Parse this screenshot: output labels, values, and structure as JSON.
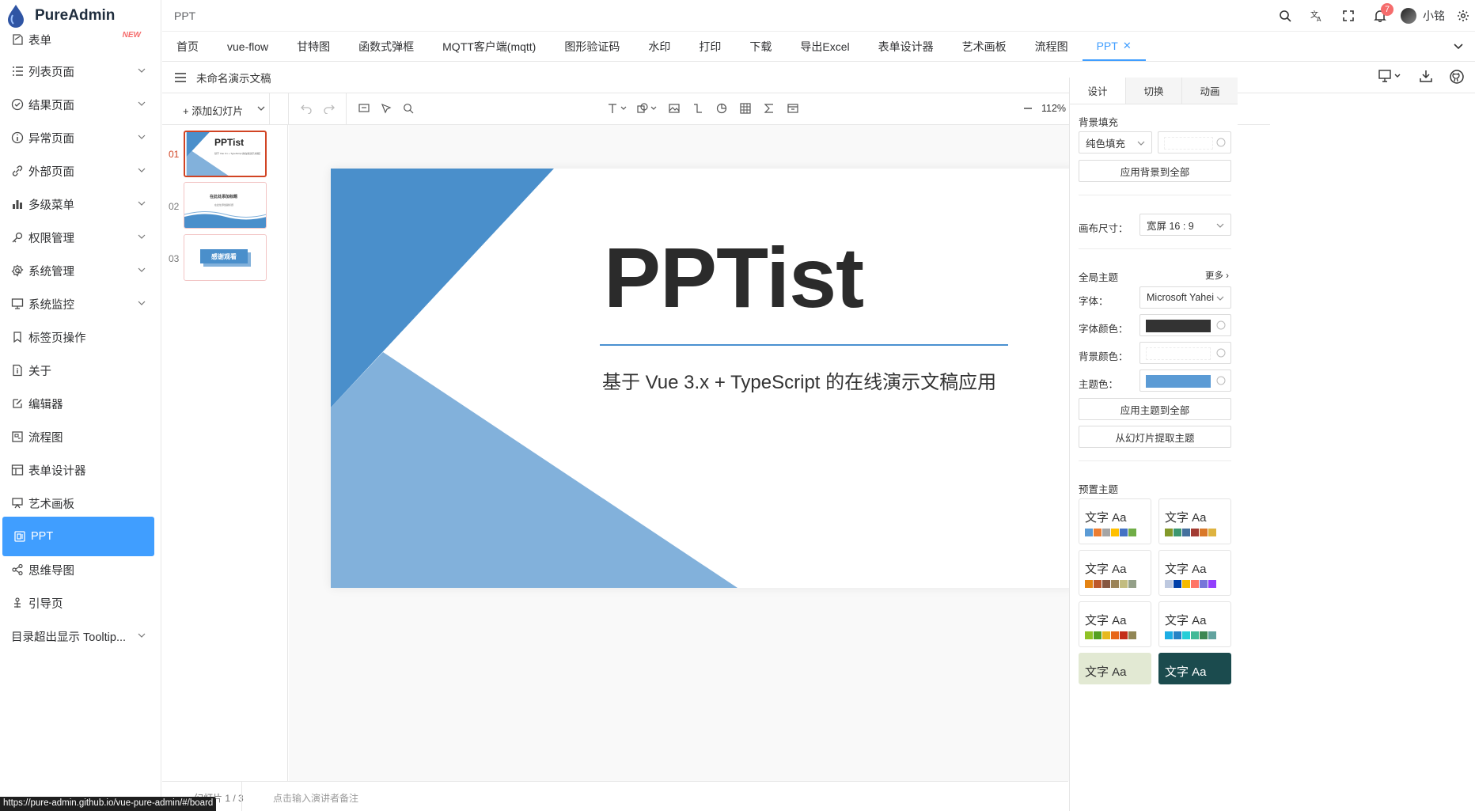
{
  "app": {
    "name": "PureAdmin"
  },
  "sidebar": {
    "items": [
      {
        "label": "表单",
        "badge": "NEW"
      },
      {
        "label": "列表页面"
      },
      {
        "label": "结果页面"
      },
      {
        "label": "异常页面"
      },
      {
        "label": "外部页面"
      },
      {
        "label": "多级菜单"
      },
      {
        "label": "权限管理"
      },
      {
        "label": "系统管理"
      },
      {
        "label": "系统监控"
      },
      {
        "label": "标签页操作"
      },
      {
        "label": "关于"
      },
      {
        "label": "编辑器"
      },
      {
        "label": "流程图"
      },
      {
        "label": "表单设计器"
      },
      {
        "label": "艺术画板"
      },
      {
        "label": "PPT"
      },
      {
        "label": "思维导图"
      },
      {
        "label": "引导页"
      },
      {
        "label": "目录超出显示 Tooltip..."
      }
    ]
  },
  "header": {
    "breadcrumb": "PPT",
    "notification_count": "7",
    "username": "小铭"
  },
  "tabs": [
    "首页",
    "vue-flow",
    "甘特图",
    "函数式弹框",
    "MQTT客户端(mqtt)",
    "图形验证码",
    "水印",
    "打印",
    "下载",
    "导出Excel",
    "表单设计器",
    "艺术画板",
    "流程图",
    "PPT"
  ],
  "ppt": {
    "doc_title": "未命名演示文稿",
    "add_slide": "+ 添加幻灯片",
    "zoom": "112%",
    "slide_numbers": [
      "01",
      "02",
      "03"
    ],
    "thumb_texts": [
      "PPTist",
      "基于 Vue 3.x + TypeScript 的在线演示文稿应用",
      "在此处添加标题",
      "在此处添加副标题",
      "感谢观看"
    ],
    "slide": {
      "title": "PPTist",
      "subtitle": "基于 Vue 3.x + TypeScript 的在线演示文稿应用",
      "dark_blue": "#4a8fcb",
      "light_blue": "#82b1db"
    },
    "notes_count": "幻灯片 1 / 3",
    "notes_placeholder": "点击输入演讲者备注"
  },
  "panel": {
    "tabs": [
      "设计",
      "切换",
      "动画"
    ],
    "bg_fill_label": "背景填充",
    "bg_fill_type": "纯色填充",
    "apply_bg_all": "应用背景到全部",
    "canvas_size_label": "画布尺寸：",
    "canvas_size": "宽屏 16 : 9",
    "global_theme": "全局主题",
    "more": "更多",
    "font_label": "字体：",
    "font_value": "Microsoft Yahei",
    "font_color_label": "字体颜色：",
    "font_color": "#333333",
    "bg_color_label": "背景颜色：",
    "theme_color_label": "主题色：",
    "theme_color": "#5b9bd5",
    "apply_theme_all": "应用主题到全部",
    "extract_theme": "从幻灯片提取主题",
    "preset_themes": "预置主题",
    "theme_sample": "文字 Aa",
    "presets": [
      [
        "#5b9bd5",
        "#ed7d31",
        "#a5a5a5",
        "#ffc000",
        "#4472c4",
        "#70ad47"
      ],
      [
        "#83992a",
        "#3c9770",
        "#44709d",
        "#a23b32",
        "#d97828",
        "#deb340"
      ],
      [
        "#e48312",
        "#bd582c",
        "#865640",
        "#9b8357",
        "#c2bc80",
        "#94a088"
      ],
      [
        "#bdc8df",
        "#003fa9",
        "#f5ba00",
        "#ff7567",
        "#7676d9",
        "#923ffc"
      ],
      [
        "#90c226",
        "#54a021",
        "#e6b91e",
        "#e76618",
        "#c42f1a",
        "#918655"
      ],
      [
        "#1cade4",
        "#2683c6",
        "#27ced7",
        "#42ba97",
        "#3e8853",
        "#62a39f"
      ]
    ],
    "preset7_bg": "#e2e9d3",
    "preset8_bg": "#1b4b4e"
  },
  "status_url": "https://pure-admin.github.io/vue-pure-admin/#/board"
}
